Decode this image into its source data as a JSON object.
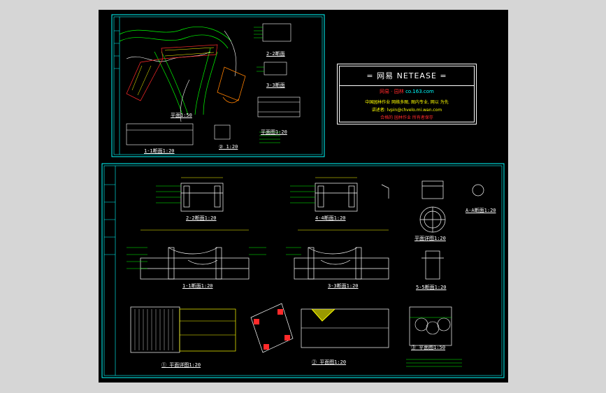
{
  "title_block": {
    "brand": "= 网易 NETEASE =",
    "sub_prefix": "网易 · 园林",
    "sub_domain": "co.163.com",
    "line1": "中国园林作业 网络多图, 图内专业, 网以 为先",
    "line2": "讲述者: lvpin@chvelo.mi.wan.com",
    "line3": "合格的 园林作业 所有者保存"
  },
  "view_labels": {
    "top_a": "1-1断面1:20",
    "top_b": "平面1:50",
    "top_c": "平面图1:20",
    "top_d": "② 1:20",
    "top_e": "2-2断面",
    "top_f": "3-3断面",
    "sec_2": "2-2断面1:20",
    "sec_4": "4-4断面1:20",
    "sec_1": "1-1断面1:20",
    "sec_3": "3-3断面1:20",
    "sec_5": "5-5断面1:20",
    "sec_a": "A-A断面1:20",
    "detail_round": "平面详图1:20",
    "plan_1": "① 平面详图1:20",
    "plan_2": "② 平面图1:20",
    "plan_3": "③ 平面图1:50"
  },
  "colors": {
    "background": "#d6d6d6",
    "sheet": "#000000",
    "frame": "#00ffff",
    "lines": "#ffffff",
    "accent_green": "#00ff00",
    "accent_yellow": "#ffff00",
    "accent_red": "#ff2a2a"
  }
}
